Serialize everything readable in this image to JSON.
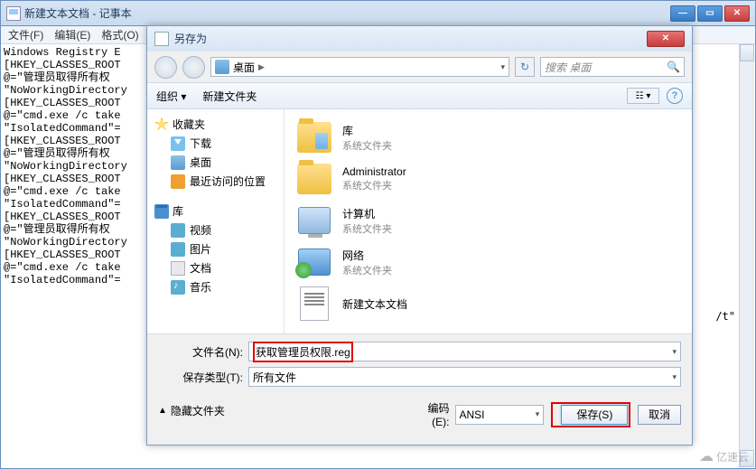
{
  "notepad": {
    "title": "新建文本文档 - 记事本",
    "menu": {
      "file": "文件(F)",
      "edit": "编辑(E)",
      "format": "格式(O)"
    },
    "content": "Windows Registry E\n[HKEY_CLASSES_ROOT\n@=\"管理员取得所有权\n\"NoWorkingDirectory\n[HKEY_CLASSES_ROOT\n@=\"cmd.exe /c take\n\"IsolatedCommand\"=\n[HKEY_CLASSES_ROOT\n@=\"管理员取得所有权\n\"NoWorkingDirectory\n[HKEY_CLASSES_ROOT\n@=\"cmd.exe /c take\n\"IsolatedCommand\"=\n[HKEY_CLASSES_ROOT\n@=\"管理员取得所有权\n\"NoWorkingDirectory\n[HKEY_CLASSES_ROOT\n@=\"cmd.exe /c take\n\"IsolatedCommand\"=",
    "trail": "/t\""
  },
  "dialog": {
    "title": "另存为",
    "breadcrumb": {
      "location": "桌面"
    },
    "search_placeholder": "搜索 桌面",
    "toolbar": {
      "organize": "组织 ▾",
      "newfolder": "新建文件夹"
    },
    "sidebar": {
      "favorites": "收藏夹",
      "downloads": "下载",
      "desktop": "桌面",
      "recent": "最近访问的位置",
      "libraries": "库",
      "videos": "视频",
      "pictures": "图片",
      "documents": "文档",
      "music": "音乐"
    },
    "items": [
      {
        "name": "库",
        "sub": "系统文件夹"
      },
      {
        "name": "Administrator",
        "sub": "系统文件夹"
      },
      {
        "name": "计算机",
        "sub": "系统文件夹"
      },
      {
        "name": "网络",
        "sub": "系统文件夹"
      },
      {
        "name": "新建文本文档",
        "sub": ""
      }
    ],
    "filename_label": "文件名(N):",
    "filename_value": "获取管理员权限.reg",
    "filetype_label": "保存类型(T):",
    "filetype_value": "所有文件",
    "hide_folders": "隐藏文件夹",
    "encoding_label": "编码(E):",
    "encoding_value": "ANSI",
    "save_btn": "保存(S)",
    "cancel_btn": "取消"
  },
  "watermark": "亿速云"
}
